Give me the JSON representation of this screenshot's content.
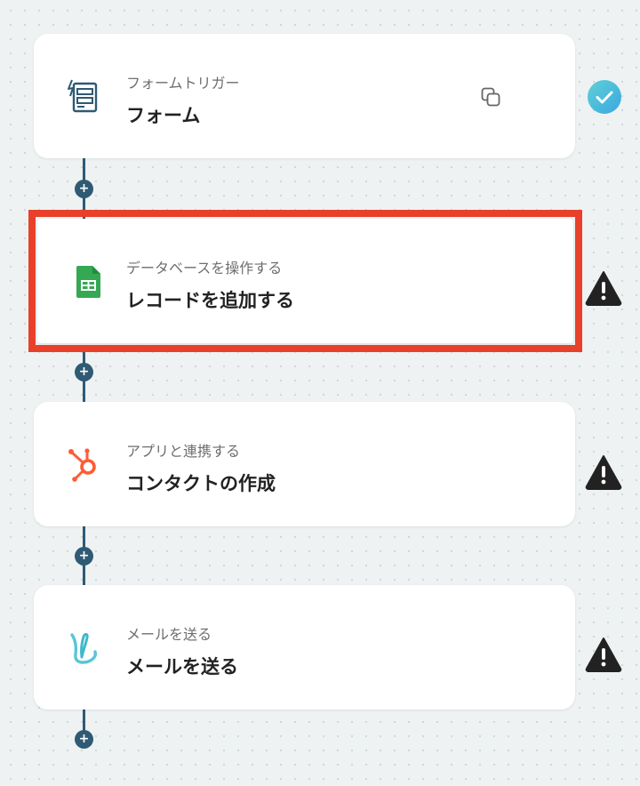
{
  "colors": {
    "connector": "#2f5a74",
    "highlight": "#e8402a",
    "success": "#4ec3d9",
    "warning": "#222222"
  },
  "flow": {
    "add_step_symbol": "+",
    "steps": [
      {
        "subtitle": "フォームトリガー",
        "title": "フォーム",
        "icon": "form-trigger-icon",
        "status": "success"
      },
      {
        "subtitle": "データベースを操作する",
        "title": "レコードを追加する",
        "icon": "google-sheets-icon",
        "status": "warning"
      },
      {
        "subtitle": "アプリと連携する",
        "title": "コンタクトの作成",
        "icon": "hubspot-icon",
        "status": "warning"
      },
      {
        "subtitle": "メールを送る",
        "title": "メールを送る",
        "icon": "mail-icon",
        "status": "warning"
      }
    ]
  }
}
